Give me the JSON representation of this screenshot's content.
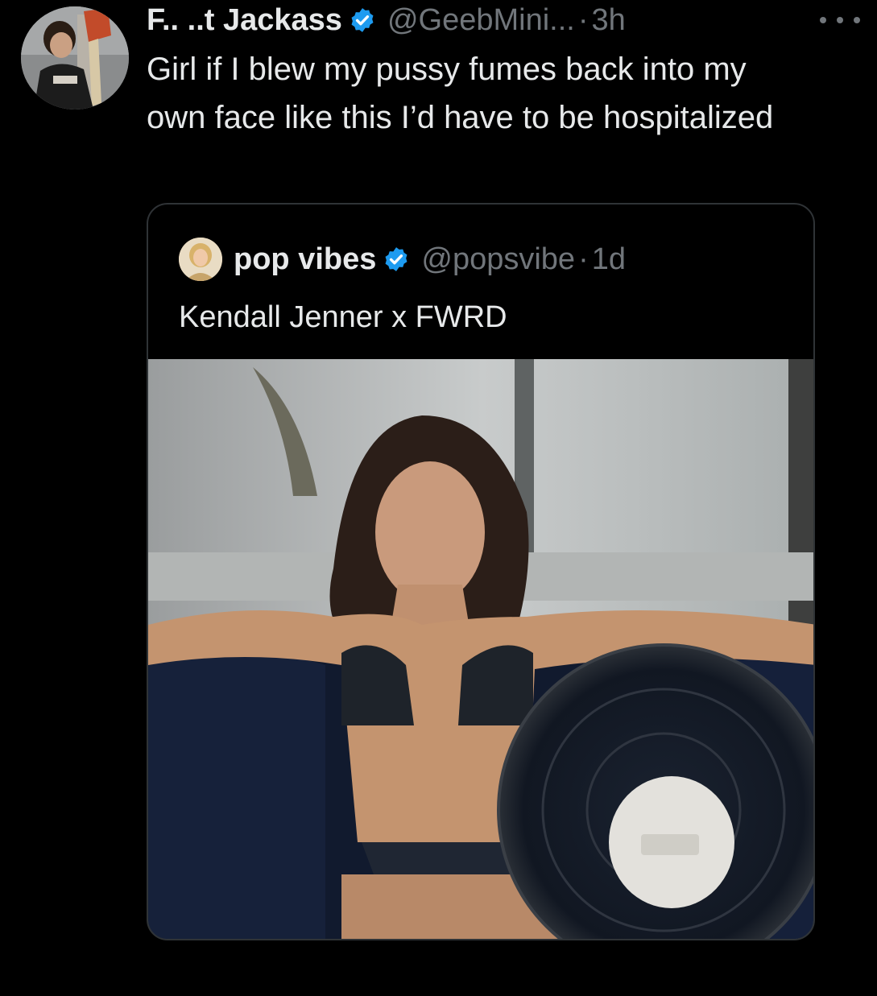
{
  "tweet": {
    "display_name": "F.. ..t Jackass",
    "handle": "@GeebMini...",
    "separator": "·",
    "time": "3h",
    "text": "Girl if I blew my pussy fumes back into my own face like this I’d have to be hospitalized",
    "avatar_icon": "user-avatar-photo",
    "more_icon": "more-options-icon"
  },
  "quote": {
    "display_name": "pop vibes",
    "handle": "@popsvibe",
    "separator": "·",
    "time": "1d",
    "text": "Kendall Jenner x FWRD",
    "avatar_icon": "quoted-user-avatar-photo",
    "media_icon": "photo-woman-bikini-with-fan"
  },
  "colors": {
    "background": "#000000",
    "text": "#e7e9ea",
    "muted": "#71767b",
    "verified": "#1d9bf0",
    "border": "#2f3336"
  }
}
